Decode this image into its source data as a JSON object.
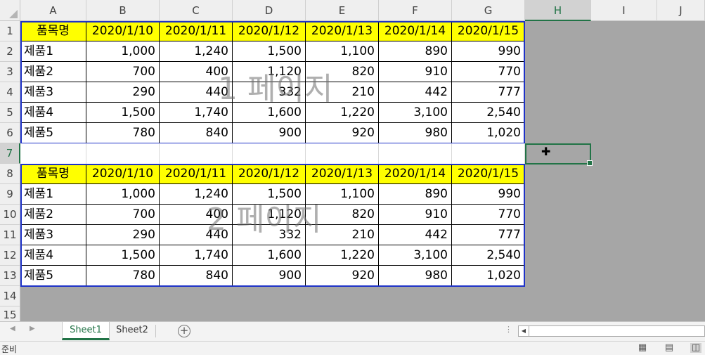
{
  "columns": [
    "A",
    "B",
    "C",
    "D",
    "E",
    "F",
    "G",
    "H",
    "I",
    "J"
  ],
  "selected_column": "H",
  "rows": [
    "1",
    "2",
    "3",
    "4",
    "5",
    "6",
    "7",
    "8",
    "9",
    "10",
    "11",
    "12",
    "13",
    "14",
    "15"
  ],
  "selected_row": "7",
  "block1": {
    "header": [
      "품목명",
      "2020/1/10",
      "2020/1/11",
      "2020/1/12",
      "2020/1/13",
      "2020/1/14",
      "2020/1/15"
    ],
    "data": [
      [
        "제품1",
        "1,000",
        "1,240",
        "1,500",
        "1,100",
        "890",
        "990"
      ],
      [
        "제품2",
        "700",
        "400",
        "1,120",
        "820",
        "910",
        "770"
      ],
      [
        "제품3",
        "290",
        "440",
        "332",
        "210",
        "442",
        "777"
      ],
      [
        "제품4",
        "1,500",
        "1,740",
        "1,600",
        "1,220",
        "3,100",
        "2,540"
      ],
      [
        "제품5",
        "780",
        "840",
        "900",
        "920",
        "980",
        "1,020"
      ]
    ],
    "watermark": "1 페이지"
  },
  "block2": {
    "header": [
      "품목명",
      "2020/1/10",
      "2020/1/11",
      "2020/1/12",
      "2020/1/13",
      "2020/1/14",
      "2020/1/15"
    ],
    "data": [
      [
        "제품1",
        "1,000",
        "1,240",
        "1,500",
        "1,100",
        "890",
        "990"
      ],
      [
        "제품2",
        "700",
        "400",
        "1,120",
        "820",
        "910",
        "770"
      ],
      [
        "제품3",
        "290",
        "440",
        "332",
        "210",
        "442",
        "777"
      ],
      [
        "제품4",
        "1,500",
        "1,740",
        "1,600",
        "1,220",
        "3,100",
        "2,540"
      ],
      [
        "제품5",
        "780",
        "840",
        "900",
        "920",
        "980",
        "1,020"
      ]
    ],
    "watermark": "2 페이지"
  },
  "tabs": [
    "Sheet1",
    "Sheet2"
  ],
  "active_tab": "Sheet1",
  "status": "준비",
  "icons": {
    "add_sheet": "plus-circle-icon",
    "nav_prev": "triangle-left-icon",
    "nav_next": "triangle-right-icon",
    "view_normal": "grid-icon",
    "view_page_layout": "page-layout-icon",
    "view_page_break": "page-break-icon",
    "cursor": "cross-cursor-icon"
  },
  "colors": {
    "accent": "#217346",
    "border_blue": "#1e32c8",
    "header_fill": "#ffff00",
    "outside_print_area": "#a6a6a6"
  }
}
